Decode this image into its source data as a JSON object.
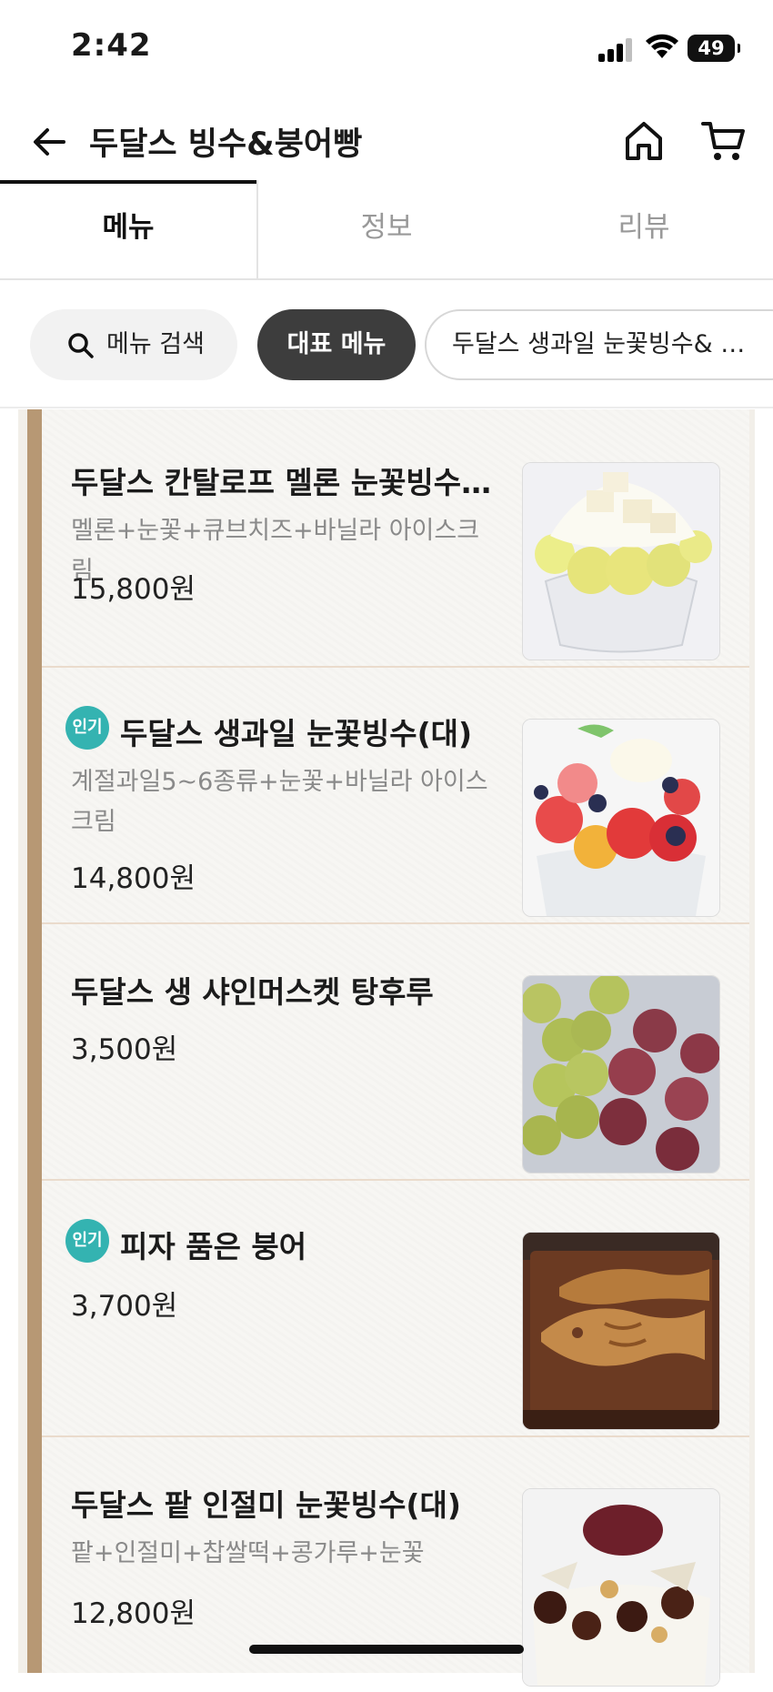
{
  "status_bar": {
    "time": "2:42",
    "battery": "49"
  },
  "header": {
    "title": "두달스 빙수&붕어빵"
  },
  "tabs": [
    {
      "label": "메뉴",
      "active": true
    },
    {
      "label": "정보",
      "active": false
    },
    {
      "label": "리뷰",
      "active": false
    }
  ],
  "chips": {
    "search_label": "메뉴 검색",
    "representative_label": "대표 메뉴",
    "category_label": "두달스 생과일 눈꽃빙수& …"
  },
  "menu_items": [
    {
      "name": "두달스 칸탈로프 멜론 눈꽃빙수(…",
      "desc": "멜론+눈꽃+큐브치즈+바닐라 아이스크림",
      "price": "15,800원",
      "badge": "",
      "image": "melon-bingsu-photo"
    },
    {
      "name": "두달스 생과일 눈꽃빙수(대)",
      "desc": "계절과일5~6종류+눈꽃+바닐라 아이스크림",
      "price": "14,800원",
      "badge": "인기",
      "image": "fruit-bingsu-photo"
    },
    {
      "name": "두달스 생 샤인머스켓 탕후루",
      "desc": "",
      "price": "3,500원",
      "badge": "",
      "image": "grape-tanghulu-photo"
    },
    {
      "name": "피자 품은 붕어",
      "desc": "",
      "price": "3,700원",
      "badge": "인기",
      "image": "bungeoppang-photo"
    },
    {
      "name": "두달스 팥 인절미 눈꽃빙수(대)",
      "desc": "팥+인절미+찹쌀떡+콩가루+눈꽃",
      "price": "12,800원",
      "badge": "",
      "image": "redbean-bingsu-photo"
    }
  ],
  "colors": {
    "badge": "#34b3b1",
    "frame": "#b79874",
    "active_chip": "#3d3d3d"
  }
}
